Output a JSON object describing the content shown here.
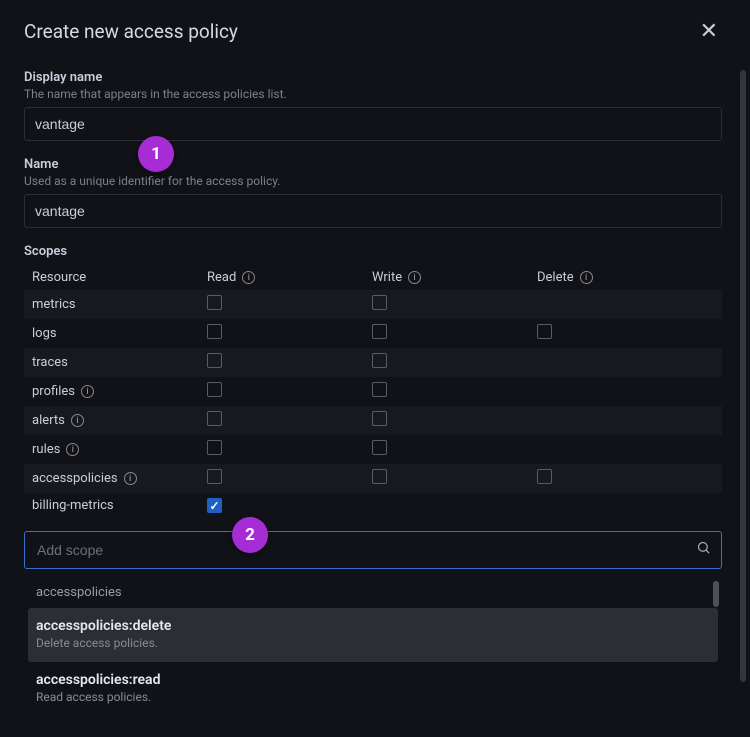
{
  "dialog": {
    "title": "Create new access policy",
    "close_label": "✕"
  },
  "display_name": {
    "label": "Display name",
    "help": "The name that appears in the access policies list.",
    "value": "vantage"
  },
  "name": {
    "label": "Name",
    "help": "Used as a unique identifier for the access policy.",
    "value": "vantage"
  },
  "scopes": {
    "label": "Scopes",
    "columns": {
      "resource": "Resource",
      "read": "Read",
      "write": "Write",
      "delete": "Delete"
    },
    "rows": [
      {
        "resource": "metrics",
        "info": false,
        "read": false,
        "write": false,
        "delete": null
      },
      {
        "resource": "logs",
        "info": false,
        "read": false,
        "write": false,
        "delete": false
      },
      {
        "resource": "traces",
        "info": false,
        "read": false,
        "write": false,
        "delete": null
      },
      {
        "resource": "profiles",
        "info": true,
        "read": false,
        "write": false,
        "delete": null
      },
      {
        "resource": "alerts",
        "info": true,
        "read": false,
        "write": false,
        "delete": null
      },
      {
        "resource": "rules",
        "info": true,
        "read": false,
        "write": false,
        "delete": null
      },
      {
        "resource": "accesspolicies",
        "info": true,
        "read": false,
        "write": false,
        "delete": false
      },
      {
        "resource": "billing-metrics",
        "info": false,
        "read": true,
        "write": null,
        "delete": null
      }
    ]
  },
  "add_scope": {
    "placeholder": "Add scope",
    "value": ""
  },
  "dropdown": {
    "group_label": "accesspolicies",
    "items": [
      {
        "title": "accesspolicies:delete",
        "desc": "Delete access policies.",
        "highlight": true
      },
      {
        "title": "accesspolicies:read",
        "desc": "Read access policies.",
        "highlight": false
      }
    ]
  },
  "badges": {
    "b1": "1",
    "b2": "2"
  },
  "colors": {
    "accent": "#1f60c4",
    "focus": "#3a6fcf",
    "badge": "#a62cd6"
  }
}
